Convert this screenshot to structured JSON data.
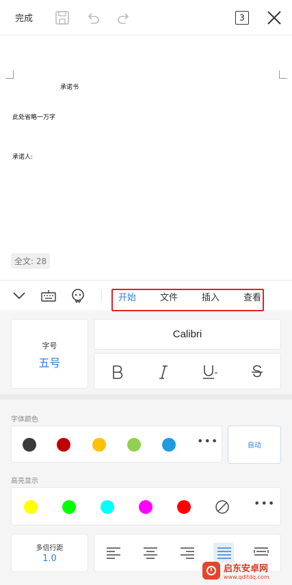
{
  "toolbar": {
    "done_label": "完成",
    "page_count": "3",
    "icons": [
      "save-icon",
      "undo-icon",
      "redo-icon",
      "close-icon"
    ]
  },
  "document": {
    "title": "承诺书",
    "body_line": "此处省略一万字",
    "signature_line": "承诺人:",
    "word_count": "全文: 28"
  },
  "tabs": {
    "items": [
      {
        "label": "开始",
        "active": true
      },
      {
        "label": "文件",
        "active": false
      },
      {
        "label": "插入",
        "active": false
      },
      {
        "label": "查看",
        "active": false
      }
    ],
    "highlight_color": "#e02020",
    "active_color": "#2f7fd6"
  },
  "format_panel": {
    "font_size_label": "字号",
    "font_size_value": "五号",
    "font_name": "Calibri",
    "style_buttons": [
      "bold",
      "italic",
      "underline",
      "strikethrough"
    ],
    "font_color_label": "字体颜色",
    "font_colors": [
      "#3a3a3a",
      "#c00000",
      "#ffc000",
      "#92d050",
      "#1e9be0"
    ],
    "auto_label": "自动",
    "highlight_label": "高亮显示",
    "highlight_colors": [
      "#ffff00",
      "#00ff00",
      "#00ffff",
      "#ff00ff",
      "#ff0000"
    ],
    "line_spacing_label": "多倍行距",
    "line_spacing_value": "1.0",
    "alignments": [
      "align-left",
      "align-center",
      "align-right",
      "justify",
      "distributed"
    ]
  },
  "watermark": {
    "name": "启东安卓网",
    "url": "www.qdltdq.com"
  }
}
